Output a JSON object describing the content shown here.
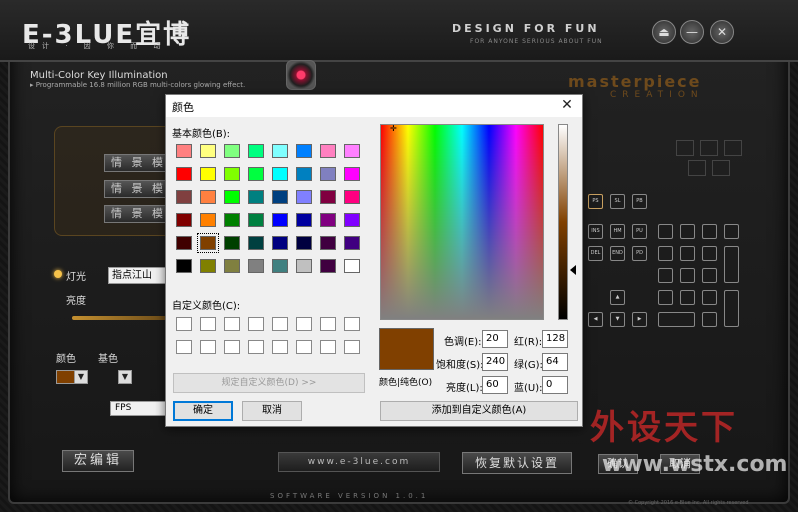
{
  "app": {
    "logo": "E-3LUE宜博",
    "logo_sub": "设计 · 因 你 而 动",
    "tagline": "DESIGN FOR FUN",
    "tagline_sub": "FOR ANYONE SERIOUS ABOUT FUN",
    "info_title": "Multi-Color Key Illumination",
    "info_sub": "▸ Programmable 16.8 million RGB multi-colors glowing effect.",
    "masterpiece": "masterpiece",
    "creation": "CREATION",
    "window_buttons": [
      "⏏",
      "—",
      "✕"
    ],
    "mode_buttons": [
      "情 景 模 式",
      "情 景 模 式",
      "情 景 模 式"
    ],
    "lamp_label": "灯光",
    "lamp_value": "指点江山",
    "brightness_label": "亮度",
    "color_label": "颜色",
    "base_color_label": "基色",
    "fps_value": "FPS",
    "macro_button": "宏编辑",
    "website": "www.e-3lue.com",
    "restore_button": "恢复默认设置",
    "confirm_button": "确认",
    "cancel_button": "取消",
    "version": "SOFTWARE VERSION 1.0.1",
    "copyright": "© Copyright 2016 e-Blue Inc. All rights reserved",
    "watermark": "外设天下",
    "watermark_url": "www.wstx.com",
    "keys": [
      "PS",
      "SL",
      "PB",
      "INS",
      "HM",
      "PU",
      "DEL",
      "END",
      "PD",
      "▲",
      "◀",
      "▼",
      "▶"
    ]
  },
  "dialog": {
    "title": "颜色",
    "close": "✕",
    "basic_colors_label": "基本颜色(B):",
    "custom_colors_label": "自定义颜色(C):",
    "define_custom_button": "规定自定义颜色(D) >>",
    "ok_button": "确定",
    "cancel_button": "取消",
    "preview_label": "颜色|纯色(O)",
    "hue_label": "色调(E):",
    "hue_value": "20",
    "sat_label": "饱和度(S):",
    "sat_value": "240",
    "lum_label": "亮度(L):",
    "lum_value": "60",
    "red_label": "红(R):",
    "red_value": "128",
    "green_label": "绿(G):",
    "green_value": "64",
    "blue_label": "蓝(U):",
    "blue_value": "0",
    "add_custom_button": "添加到自定义颜色(A)",
    "selected_color": "#804000",
    "basic_colors": [
      [
        "#ff8080",
        "#ffff80",
        "#80ff80",
        "#00ff80",
        "#80ffff",
        "#0080ff",
        "#ff80c0",
        "#ff80ff"
      ],
      [
        "#ff0000",
        "#ffff00",
        "#80ff00",
        "#00ff40",
        "#00ffff",
        "#0080c0",
        "#8080c0",
        "#ff00ff"
      ],
      [
        "#804040",
        "#ff8040",
        "#00ff00",
        "#008080",
        "#004080",
        "#8080ff",
        "#800040",
        "#ff0080"
      ],
      [
        "#800000",
        "#ff8000",
        "#008000",
        "#008040",
        "#0000ff",
        "#0000a0",
        "#800080",
        "#8000ff"
      ],
      [
        "#400000",
        "#804000",
        "#004000",
        "#004040",
        "#000080",
        "#000040",
        "#400040",
        "#400080"
      ],
      [
        "#000000",
        "#808000",
        "#808040",
        "#808080",
        "#408080",
        "#c0c0c0",
        "#400040",
        "#ffffff"
      ]
    ]
  }
}
